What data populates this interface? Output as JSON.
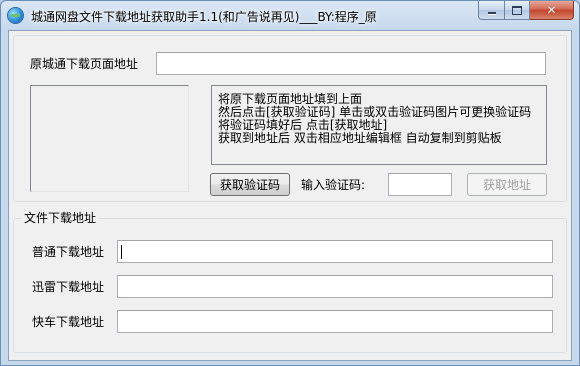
{
  "window": {
    "title": "城通网盘文件下载地址获取助手1.1(和广告说再见)___BY:程序_原",
    "close_symbol": "✕"
  },
  "page_url": {
    "label": "原城通下载页面地址",
    "value": ""
  },
  "instructions": [
    "将原下载页面地址填到上面",
    "然后点击[获取验证码] 单击或双击验证码图片可更换验证码",
    "将验证码填好后 点击[获取地址]",
    "获取到地址后 双击相应地址编辑框 自动复制到剪贴板"
  ],
  "captcha": {
    "get_button": "获取验证码",
    "input_label": "输入验证码:",
    "value": ""
  },
  "get_address_button": "获取地址",
  "file_download": {
    "group_title": "文件下载地址",
    "normal_label": "普通下载地址",
    "normal_value": "",
    "thunder_label": "迅雷下载地址",
    "thunder_value": "",
    "kuaiche_label": "快车下载地址",
    "kuaiche_value": ""
  },
  "colors": {
    "titlebar": "#c6d8ec",
    "client": "#f0f0f0",
    "close_button": "#c2452c"
  }
}
